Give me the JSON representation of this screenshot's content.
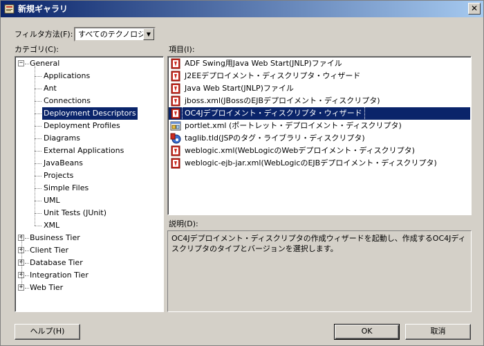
{
  "window": {
    "title": "新規ギャラリ",
    "close_glyph": "✕"
  },
  "filter": {
    "label": "フィルタ方法(F):",
    "selected": "すべてのテクノロジ",
    "arrow": "▼"
  },
  "categories": {
    "label": "カテゴリ(C):",
    "tree": [
      {
        "label": "General",
        "level": 0,
        "expander": "−"
      },
      {
        "label": "Applications",
        "level": 1
      },
      {
        "label": "Ant",
        "level": 1
      },
      {
        "label": "Connections",
        "level": 1
      },
      {
        "label": "Deployment Descriptors",
        "level": 1,
        "selected": true
      },
      {
        "label": "Deployment Profiles",
        "level": 1
      },
      {
        "label": "Diagrams",
        "level": 1
      },
      {
        "label": "External Applications",
        "level": 1
      },
      {
        "label": "JavaBeans",
        "level": 1
      },
      {
        "label": "Projects",
        "level": 1
      },
      {
        "label": "Simple Files",
        "level": 1
      },
      {
        "label": "UML",
        "level": 1
      },
      {
        "label": "Unit Tests (JUnit)",
        "level": 1
      },
      {
        "label": "XML",
        "level": 1
      },
      {
        "label": "Business Tier",
        "level": 0,
        "expander": "+"
      },
      {
        "label": "Client Tier",
        "level": 0,
        "expander": "+"
      },
      {
        "label": "Database Tier",
        "level": 0,
        "expander": "+"
      },
      {
        "label": "Integration Tier",
        "level": 0,
        "expander": "+"
      },
      {
        "label": "Web Tier",
        "level": 0,
        "expander": "+"
      }
    ]
  },
  "items": {
    "label": "項目(I):",
    "list": [
      {
        "label": "ADF Swing用Java Web Start(JNLP)ファイル",
        "icon": "wizard-icon"
      },
      {
        "label": "J2EEデプロイメント・ディスクリプタ・ウィザード",
        "icon": "wizard-icon"
      },
      {
        "label": "Java Web Start(JNLP)ファイル",
        "icon": "wizard-icon"
      },
      {
        "label": "jboss.xml(JBossのEJBデプロイメント・ディスクリプタ)",
        "icon": "wizard-icon"
      },
      {
        "label": "OC4Jデプロイメント・ディスクリプタ・ウィザード",
        "icon": "wizard-icon",
        "selected": true
      },
      {
        "label": "portlet.xml (ポートレット・デプロイメント・ディスクリプタ)",
        "icon": "portlet-icon"
      },
      {
        "label": "taglib.tld(JSPのタグ・ライブラリ・ディスクリプタ)",
        "icon": "taglib-icon"
      },
      {
        "label": "weblogic.xml(WebLogicのWebデプロイメント・ディスクリプタ)",
        "icon": "wizard-icon"
      },
      {
        "label": "weblogic-ejb-jar.xml(WebLogicのEJBデプロイメント・ディスクリプタ)",
        "icon": "wizard-icon"
      }
    ]
  },
  "description": {
    "label": "説明(D):",
    "text": "OC4Jデプロイメント・ディスクリプタの作成ウィザードを起動し、作成するOC4Jディスクリプタのタイプとバージョンを選択します。"
  },
  "buttons": {
    "help": "ヘルプ(H)",
    "ok": "OK",
    "cancel": "取消"
  },
  "colors": {
    "selection": "#0a246a",
    "face": "#d4d0c8",
    "wizard_icon": "#cc2a1f"
  }
}
